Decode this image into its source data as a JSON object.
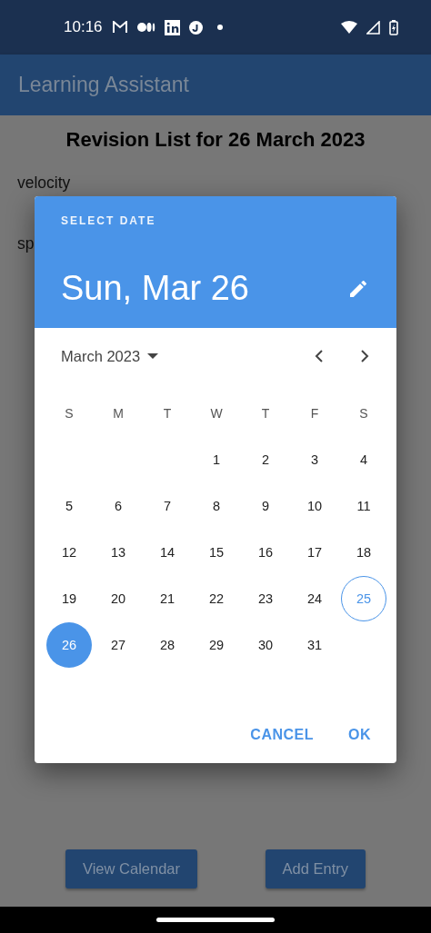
{
  "status_bar": {
    "time": "10:16"
  },
  "app_bar": {
    "title": "Learning Assistant"
  },
  "page": {
    "heading": "Revision List for 26 March 2023",
    "entries": [
      "velocity",
      "sp"
    ],
    "buttons": [
      "View Calendar",
      "Add Entry"
    ]
  },
  "dialog": {
    "label": "SELECT DATE",
    "selected_date": "Sun, Mar 26",
    "month": "March 2023",
    "weekdays": [
      "S",
      "M",
      "T",
      "W",
      "T",
      "F",
      "S"
    ],
    "weeks": [
      {
        "days": [
          {
            "kind": "blank"
          },
          {
            "kind": "blank"
          },
          {
            "kind": "blank"
          },
          {
            "kind": "day",
            "label": "1",
            "selected": false,
            "today": false
          },
          {
            "kind": "day",
            "label": "2",
            "selected": false,
            "today": false
          },
          {
            "kind": "day",
            "label": "3",
            "selected": false,
            "today": false
          },
          {
            "kind": "day",
            "label": "4",
            "selected": false,
            "today": false
          }
        ]
      },
      {
        "days": [
          {
            "kind": "day",
            "label": "5",
            "selected": false,
            "today": false
          },
          {
            "kind": "day",
            "label": "6",
            "selected": false,
            "today": false
          },
          {
            "kind": "day",
            "label": "7",
            "selected": false,
            "today": false
          },
          {
            "kind": "day",
            "label": "8",
            "selected": false,
            "today": false
          },
          {
            "kind": "day",
            "label": "9",
            "selected": false,
            "today": false
          },
          {
            "kind": "day",
            "label": "10",
            "selected": false,
            "today": false
          },
          {
            "kind": "day",
            "label": "11",
            "selected": false,
            "today": false
          }
        ]
      },
      {
        "days": [
          {
            "kind": "day",
            "label": "12",
            "selected": false,
            "today": false
          },
          {
            "kind": "day",
            "label": "13",
            "selected": false,
            "today": false
          },
          {
            "kind": "day",
            "label": "14",
            "selected": false,
            "today": false
          },
          {
            "kind": "day",
            "label": "15",
            "selected": false,
            "today": false
          },
          {
            "kind": "day",
            "label": "16",
            "selected": false,
            "today": false
          },
          {
            "kind": "day",
            "label": "17",
            "selected": false,
            "today": false
          },
          {
            "kind": "day",
            "label": "18",
            "selected": false,
            "today": false
          }
        ]
      },
      {
        "days": [
          {
            "kind": "day",
            "label": "19",
            "selected": false,
            "today": false
          },
          {
            "kind": "day",
            "label": "20",
            "selected": false,
            "today": false
          },
          {
            "kind": "day",
            "label": "21",
            "selected": false,
            "today": false
          },
          {
            "kind": "day",
            "label": "22",
            "selected": false,
            "today": false
          },
          {
            "kind": "day",
            "label": "23",
            "selected": false,
            "today": false
          },
          {
            "kind": "day",
            "label": "24",
            "selected": false,
            "today": false
          },
          {
            "kind": "day",
            "label": "25",
            "selected": false,
            "today": true
          }
        ]
      },
      {
        "days": [
          {
            "kind": "day",
            "label": "26",
            "selected": true,
            "today": false
          },
          {
            "kind": "day",
            "label": "27",
            "selected": false,
            "today": false
          },
          {
            "kind": "day",
            "label": "28",
            "selected": false,
            "today": false
          },
          {
            "kind": "day",
            "label": "29",
            "selected": false,
            "today": false
          },
          {
            "kind": "day",
            "label": "30",
            "selected": false,
            "today": false
          },
          {
            "kind": "day",
            "label": "31",
            "selected": false,
            "today": false
          },
          {
            "kind": "blank"
          }
        ]
      }
    ],
    "actions": [
      "CANCEL",
      "OK"
    ]
  }
}
